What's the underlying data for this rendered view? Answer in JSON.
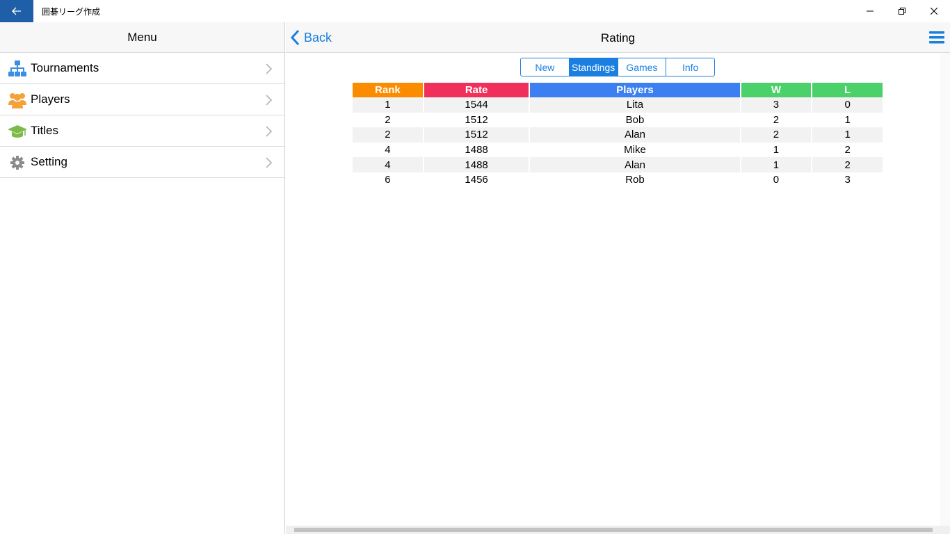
{
  "window": {
    "title": "囲碁リーグ作成"
  },
  "menu": {
    "header": "Menu",
    "items": [
      {
        "label": "Tournaments",
        "icon": "tournament-tree-icon",
        "color": "#3a8ee6"
      },
      {
        "label": "Players",
        "icon": "players-group-icon",
        "color": "#f4a13a"
      },
      {
        "label": "Titles",
        "icon": "graduation-cap-icon",
        "color": "#7cbb4a"
      },
      {
        "label": "Setting",
        "icon": "gear-icon",
        "color": "#8a8a8a"
      }
    ]
  },
  "nav": {
    "back_label": "Back",
    "title": "Rating"
  },
  "segments": {
    "items": [
      "New",
      "Standings",
      "Games",
      "Info"
    ],
    "selected": "Standings"
  },
  "table": {
    "headers": [
      {
        "label": "Rank",
        "color": "#fb8c00"
      },
      {
        "label": "Rate",
        "color": "#f0305a"
      },
      {
        "label": "Players",
        "color": "#3b7ff0"
      },
      {
        "label": "W",
        "color": "#4cd06a"
      },
      {
        "label": "L",
        "color": "#4cd06a"
      }
    ],
    "rows": [
      [
        "1",
        "1544",
        "Lita",
        "3",
        "0"
      ],
      [
        "2",
        "1512",
        "Bob",
        "2",
        "1"
      ],
      [
        "2",
        "1512",
        "Alan",
        "2",
        "1"
      ],
      [
        "4",
        "1488",
        "Mike",
        "1",
        "2"
      ],
      [
        "4",
        "1488",
        "Alan",
        "1",
        "2"
      ],
      [
        "6",
        "1456",
        "Rob",
        "0",
        "3"
      ]
    ]
  },
  "colors": {
    "accent": "#1a7fe0",
    "titlebar_back": "#1f5fa8"
  }
}
